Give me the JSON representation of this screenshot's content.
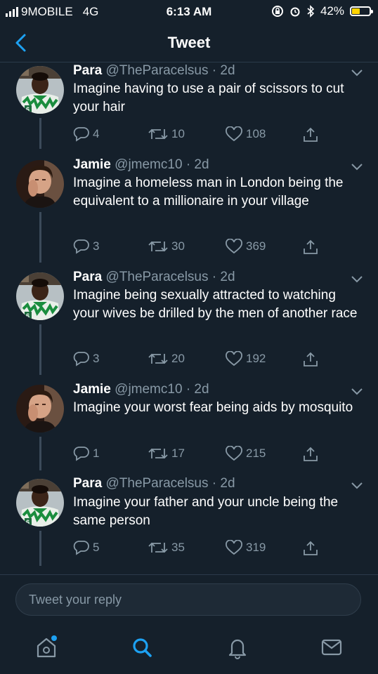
{
  "status": {
    "carrier": "9MOBILE",
    "network": "4G",
    "time": "6:13 AM",
    "battery": "42%",
    "battery_level": 0.42
  },
  "header": {
    "title": "Tweet",
    "back_icon": "chevron-left-icon"
  },
  "tweets": [
    {
      "name": "Para",
      "handle": "@TheParacelsus",
      "time": "· 2d",
      "text": "Imagine having to use a pair of scissors to cut your hair",
      "replies": "4",
      "retweets": "10",
      "likes": "108"
    },
    {
      "name": "Jamie",
      "handle": "@jmemc10",
      "time": "· 2d",
      "text": "Imagine a homeless man in London being the equivalent to a millionaire in your village",
      "replies": "3",
      "retweets": "30",
      "likes": "369"
    },
    {
      "name": "Para",
      "handle": "@TheParacelsus",
      "time": "· 2d",
      "text": "Imagine being sexually attracted to watching your wives be drilled by the men of another race",
      "replies": "3",
      "retweets": "20",
      "likes": "192"
    },
    {
      "name": "Jamie",
      "handle": "@jmemc10",
      "time": "· 2d",
      "text": "Imagine your worst fear being aids by mosquito",
      "replies": "1",
      "retweets": "17",
      "likes": "215"
    },
    {
      "name": "Para",
      "handle": "@TheParacelsus",
      "time": "· 2d",
      "text": "Imagine your father and your uncle being the same person",
      "replies": "5",
      "retweets": "35",
      "likes": "319"
    }
  ],
  "reply": {
    "placeholder": "Tweet your reply"
  },
  "tabs": [
    "home-icon",
    "search-icon",
    "notifications-icon",
    "messages-icon"
  ],
  "colors": {
    "background": "#15202b",
    "accent": "#1da1f2",
    "muted": "#8899a6",
    "battery": "#ffd400"
  }
}
